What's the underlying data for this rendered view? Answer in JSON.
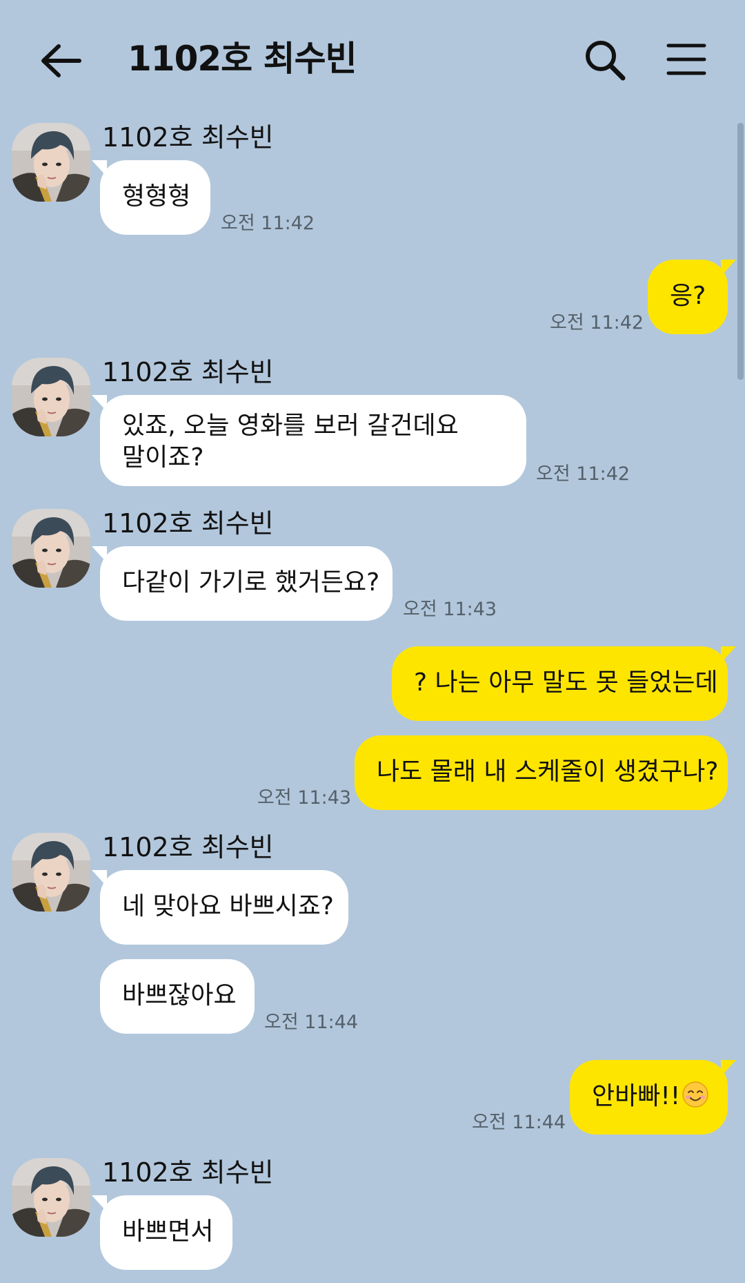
{
  "header": {
    "title": "1102호 최수빈"
  },
  "chat": {
    "sender_name": "1102호 최수빈",
    "messages": [
      {
        "text": "형형형",
        "time": "오전 11:42"
      },
      {
        "text": "응?",
        "time": "오전 11:42"
      },
      {
        "text": "있죠, 오늘 영화를 보러 갈건데요",
        "text2": "말이죠?",
        "time": "오전 11:42"
      },
      {
        "text": "다같이 가기로 했거든요?",
        "time": "오전 11:43"
      },
      {
        "text": "? 나는 아무 말도 못 들었는데"
      },
      {
        "text": "나도 몰래 내 스케줄이 생겼구나?",
        "time": "오전 11:43"
      },
      {
        "text": "네 맞아요 바쁘시죠?"
      },
      {
        "text": "바쁘잖아요",
        "time": "오전 11:44"
      },
      {
        "text": "안바빠!!",
        "time": "오전 11:44"
      },
      {
        "text": "바쁘면서"
      }
    ]
  },
  "icons": {
    "back": "arrow-left-icon",
    "search": "search-icon",
    "menu": "hamburger-menu-icon",
    "emoji": "smiling-face-icon"
  },
  "colors": {
    "background": "#b2c7dc",
    "incoming_bubble": "#ffffff",
    "outgoing_bubble": "#fee500"
  }
}
